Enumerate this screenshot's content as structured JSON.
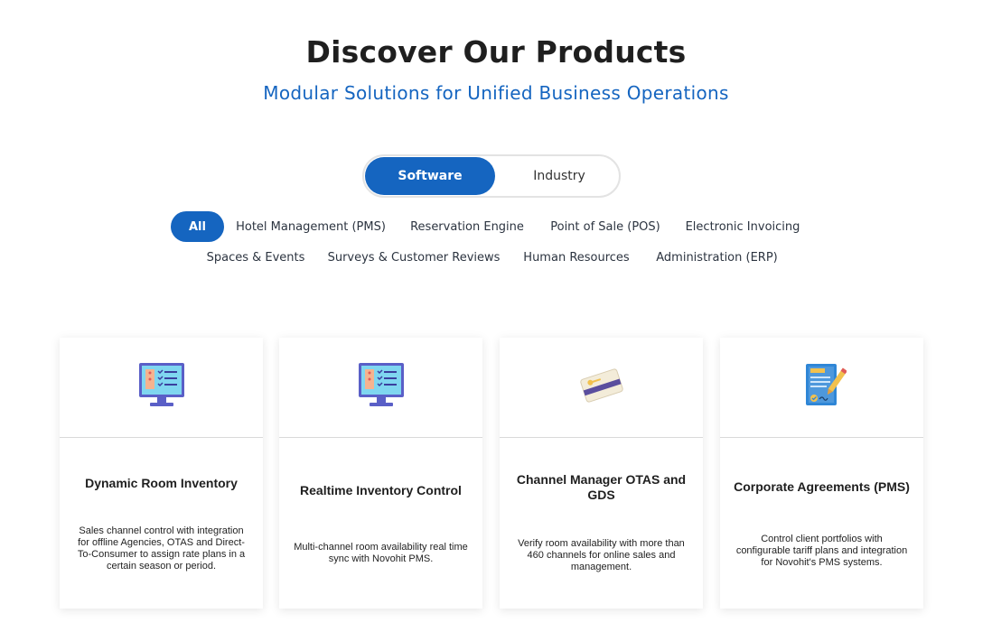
{
  "header": {
    "title": "Discover Our Products",
    "subtitle": "Modular Solutions for Unified Business Operations"
  },
  "toggle": {
    "options": [
      "Software",
      "Industry"
    ],
    "selected": "Software"
  },
  "filters": {
    "row1": [
      "All",
      "Hotel Management (PMS)",
      "Reservation Engine",
      "Point of Sale (POS)",
      "Electronic Invoicing"
    ],
    "row2": [
      "Spaces & Events",
      "Surveys & Customer Reviews",
      "Human Resources",
      "Administration (ERP)"
    ],
    "selected": "All"
  },
  "cards": [
    {
      "icon": "monitor-checklist-icon",
      "title": "Dynamic Room Inventory",
      "description": "Sales channel control with integration for offline Agencies, OTAS and Direct-To-Consumer to assign rate plans in a certain season or period."
    },
    {
      "icon": "monitor-checklist-icon",
      "title": "Realtime Inventory Control",
      "description": "Multi-channel room availability real time sync with Novohit PMS."
    },
    {
      "icon": "keycard-icon",
      "title": "Channel Manager OTAS and GDS",
      "description": "Verify room availability with more than 460 channels for online sales and management."
    },
    {
      "icon": "contract-pen-icon",
      "title": "Corporate Agreements (PMS)",
      "description": "Control client portfolios with configurable tariff plans and integration for Novohit's PMS systems."
    }
  ],
  "colors": {
    "accent": "#1565c0",
    "text": "#1f1f1f"
  }
}
